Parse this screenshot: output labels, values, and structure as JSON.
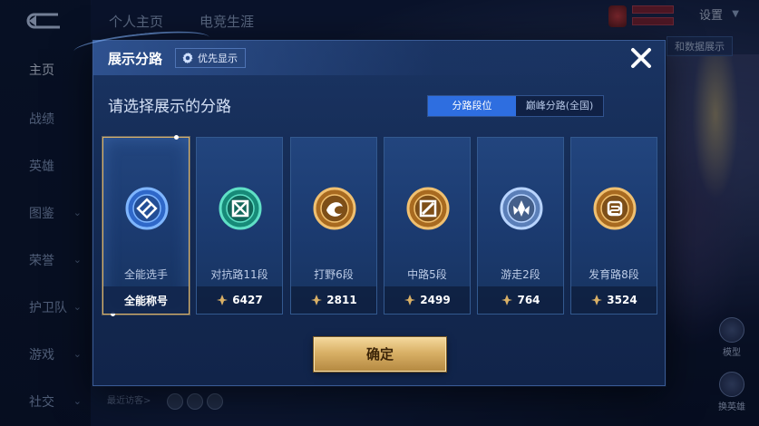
{
  "colors": {
    "accent_blue": "#2e6ee0",
    "gold": "#d9b066",
    "modal_bg": "#1a3463"
  },
  "background": {
    "top_tabs": [
      "个人主页",
      "电竞生涯"
    ],
    "settings_label": "设置",
    "data_button_label": "和数据展示",
    "recent_visitors_label": "最近访客>",
    "right_floats": [
      {
        "icon": "model-icon",
        "label": "模型"
      },
      {
        "icon": "switch-hero-icon",
        "label": "换英雄"
      }
    ]
  },
  "sidebar": {
    "items": [
      {
        "label": "主页",
        "active": true,
        "has_chevron": false
      },
      {
        "label": "战绩",
        "active": false,
        "has_chevron": false
      },
      {
        "label": "英雄",
        "active": false,
        "has_chevron": false
      },
      {
        "label": "图鉴",
        "active": false,
        "has_chevron": true
      },
      {
        "label": "荣誉",
        "active": false,
        "has_chevron": true
      },
      {
        "label": "护卫队",
        "active": false,
        "has_chevron": true
      },
      {
        "label": "游戏",
        "active": false,
        "has_chevron": true
      },
      {
        "label": "社交",
        "active": false,
        "has_chevron": true
      }
    ]
  },
  "modal": {
    "title": "展示分路",
    "priority_button_label": "优先显示",
    "subtitle": "请选择展示的分路",
    "tabs": [
      {
        "label": "分路段位",
        "active": true
      },
      {
        "label": "巅峰分路(全国)",
        "active": false
      }
    ],
    "cards": [
      {
        "name": "全能选手",
        "footer": "全能称号",
        "points": null,
        "selected": true,
        "emblem": "all-round-emblem-icon"
      },
      {
        "name": "对抗路11段",
        "footer": "6427",
        "points": 6427,
        "selected": false,
        "emblem": "clash-lane-emblem-icon"
      },
      {
        "name": "打野6段",
        "footer": "2811",
        "points": 2811,
        "selected": false,
        "emblem": "jungle-emblem-icon"
      },
      {
        "name": "中路5段",
        "footer": "2499",
        "points": 2499,
        "selected": false,
        "emblem": "mid-lane-emblem-icon"
      },
      {
        "name": "游走2段",
        "footer": "764",
        "points": 764,
        "selected": false,
        "emblem": "roam-emblem-icon"
      },
      {
        "name": "发育路8段",
        "footer": "3524",
        "points": 3524,
        "selected": false,
        "emblem": "farm-lane-emblem-icon"
      }
    ],
    "confirm_label": "确定"
  }
}
